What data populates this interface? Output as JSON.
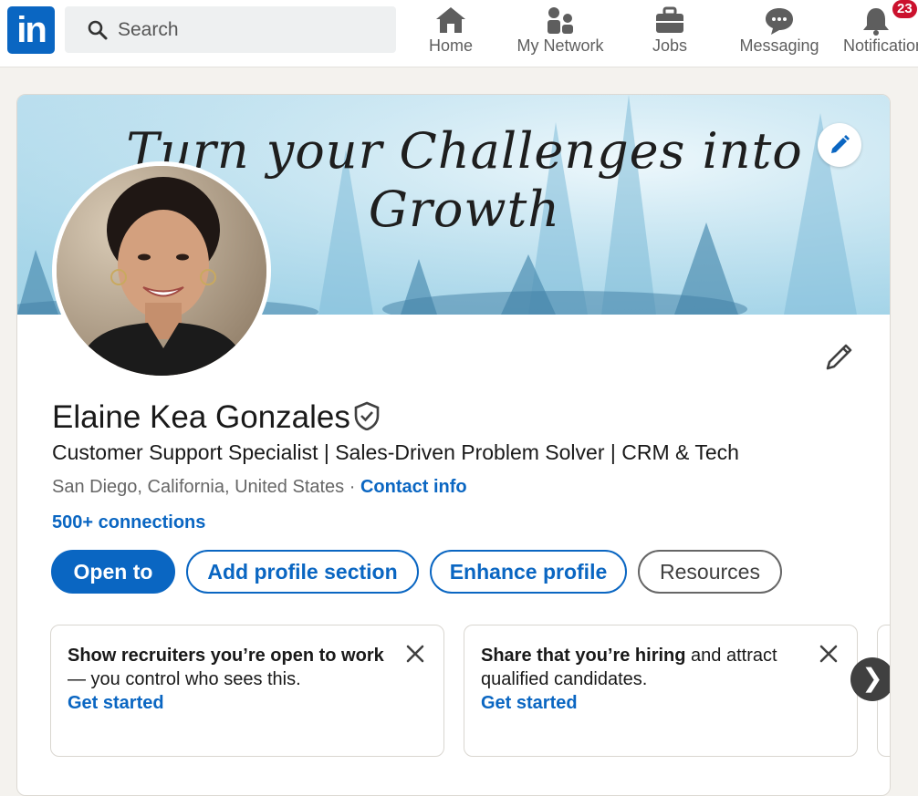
{
  "nav": {
    "logo": "in",
    "search_placeholder": "Search",
    "items": [
      {
        "label": "Home",
        "icon": "home-icon"
      },
      {
        "label": "My Network",
        "icon": "network-icon"
      },
      {
        "label": "Jobs",
        "icon": "briefcase-icon"
      },
      {
        "label": "Messaging",
        "icon": "chat-icon"
      },
      {
        "label": "Notifications",
        "icon": "bell-icon",
        "badge": "23"
      }
    ]
  },
  "profile": {
    "banner_text_line1": "Turn your Challenges into",
    "banner_text_line2": "Growth",
    "name": "Elaine Kea Gonzales",
    "headline": "Customer Support Specialist | Sales-Driven Problem Solver | CRM & Tech",
    "location": "San Diego, California, United States",
    "separator": " · ",
    "contact_info": "Contact info",
    "connections": "500+ connections"
  },
  "actions": {
    "open_to": "Open to",
    "add_section": "Add profile section",
    "enhance": "Enhance profile",
    "resources": "Resources"
  },
  "suggestions": [
    {
      "bold": "Show recruiters you’re open to work",
      "rest": " — you control who sees this.",
      "cta": "Get started"
    },
    {
      "bold": "Share that you’re hiring",
      "rest": " and attract qualified candidates.",
      "cta": "Get started"
    }
  ],
  "colors": {
    "brand": "#0a66c2",
    "badge": "#cb112d"
  }
}
